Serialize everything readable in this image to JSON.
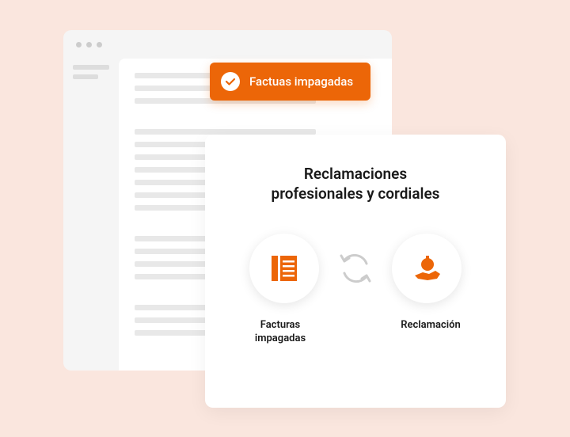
{
  "badge": {
    "label": "Factuas impagadas"
  },
  "card": {
    "title_line1": "Reclamaciones",
    "title_line2": "profesionales y cordiales",
    "icon1_label": "Facturas impagadas",
    "icon2_label": "Reclamación"
  },
  "colors": {
    "accent": "#ec6608"
  }
}
